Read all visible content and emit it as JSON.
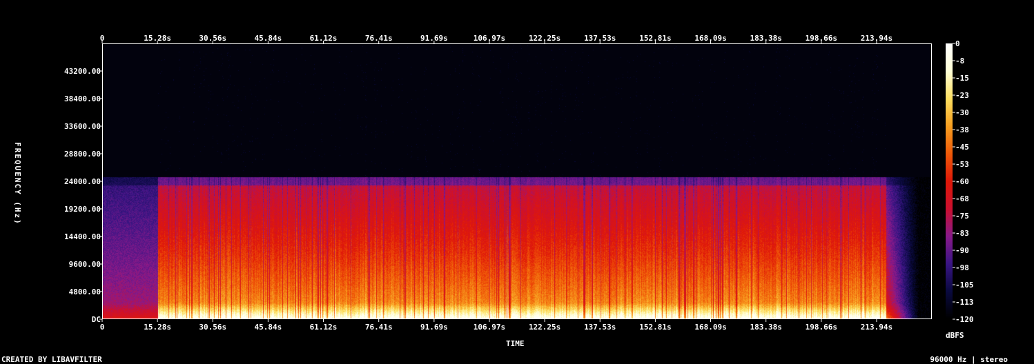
{
  "chart_data": {
    "type": "heatmap",
    "xlabel": "TIME",
    "ylabel": "FREQUENCY (Hz)",
    "x_ticks": [
      "0",
      "15.28s",
      "30.56s",
      "45.84s",
      "61.12s",
      "76.41s",
      "91.69s",
      "106.97s",
      "122.25s",
      "137.53s",
      "152.81s",
      "168.09s",
      "183.38s",
      "198.66s",
      "213.94s"
    ],
    "x_tick_values": [
      0,
      15.28,
      30.56,
      45.84,
      61.12,
      76.41,
      91.69,
      106.97,
      122.25,
      137.53,
      152.81,
      168.09,
      183.38,
      198.66,
      213.94
    ],
    "xlim": [
      0,
      229.2
    ],
    "y_ticks": [
      "DC",
      "4800.00",
      "9600.00",
      "14400.00",
      "19200.00",
      "24000.00",
      "28800.00",
      "33600.00",
      "38400.00",
      "43200.00"
    ],
    "y_tick_values": [
      0,
      4800,
      9600,
      14400,
      19200,
      24000,
      28800,
      33600,
      38400,
      43200
    ],
    "ylim": [
      0,
      48000
    ],
    "colorbar_label": "dBFS",
    "colorbar_ticks": [
      "0",
      "-8",
      "-15",
      "-23",
      "-30",
      "-38",
      "-45",
      "-53",
      "-60",
      "-68",
      "-75",
      "-83",
      "-90",
      "-98",
      "-105",
      "-113",
      "-120"
    ],
    "colorbar_range": [
      -120,
      0
    ],
    "content_cutoff_hz": 24000,
    "active_start_s": 15.28,
    "active_end_s": 216.5,
    "fade_end_s": 225.6,
    "colormap": [
      "#000000",
      "#0a0a40",
      "#3a1585",
      "#8a1a8a",
      "#cc1030",
      "#e01808",
      "#f05a08",
      "#f8a020",
      "#fde060",
      "#ffffd8",
      "#ffffff"
    ]
  },
  "footer": {
    "left": "CREATED BY LIBAVFILTER",
    "right": "96000 Hz | stereo"
  }
}
